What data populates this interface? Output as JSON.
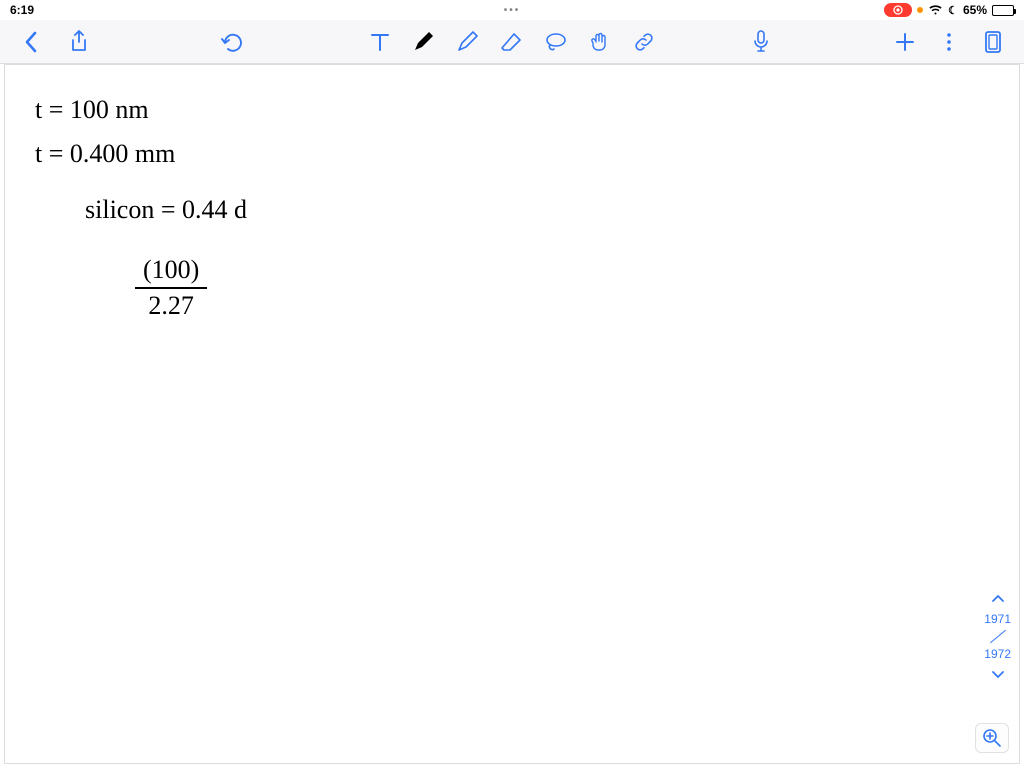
{
  "status": {
    "time": "6:19",
    "ellipsis": "•••",
    "battery_pct": "65%",
    "recording_icon": "record-icon",
    "orange_dot": true
  },
  "toolbar": {
    "back": "back-icon",
    "share": "share-icon",
    "undo": "undo-icon",
    "tools": {
      "text": "text-tool-icon",
      "marker": "marker-tool-icon",
      "pen": "pen-tool-icon",
      "eraser": "eraser-tool-icon",
      "lasso": "lasso-tool-icon",
      "hand": "hand-tool-icon",
      "link": "link-tool-icon"
    },
    "mic": "mic-icon",
    "add": "add-icon",
    "more": "more-icon",
    "pages": "pages-icon"
  },
  "notes": {
    "line1": "t = 100 nm",
    "line2": "t = 0.400 mm",
    "line3": "silicon = 0.44 d",
    "frac_num": "(100)",
    "frac_den": "2.27"
  },
  "pagenav": {
    "current": "1971",
    "next": "1972"
  },
  "zoom": "zoom-in-icon",
  "colors": {
    "ios_blue": "#3478f6",
    "toolbar_bg": "#f7f7f9",
    "border": "#dcdcdc",
    "record_red": "#ff3b30",
    "orange": "#ff9500"
  }
}
